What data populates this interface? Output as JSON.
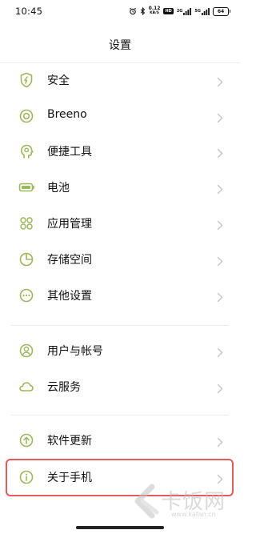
{
  "status_bar": {
    "time": "10:45",
    "net_speed_value": "0.12",
    "net_speed_unit": "KB/S",
    "hd_label": "HD",
    "sig1_label": "2G",
    "sig2_label": "5G",
    "battery": "64"
  },
  "header": {
    "title": "设置"
  },
  "menu": {
    "items": [
      {
        "label": "安全",
        "icon": "shield-bolt-icon"
      },
      {
        "label": "Breeno",
        "icon": "breeno-circle-icon"
      },
      {
        "label": "便捷工具",
        "icon": "head-gear-icon"
      },
      {
        "label": "电池",
        "icon": "battery-icon"
      },
      {
        "label": "应用管理",
        "icon": "apps-grid-icon"
      },
      {
        "label": "存储空间",
        "icon": "pie-chart-icon"
      },
      {
        "label": "其他设置",
        "icon": "more-dots-icon"
      },
      {
        "label": "用户与帐号",
        "icon": "user-account-icon"
      },
      {
        "label": "云服务",
        "icon": "cloud-icon"
      },
      {
        "label": "软件更新",
        "icon": "upload-arrow-icon"
      },
      {
        "label": "关于手机",
        "icon": "info-icon"
      }
    ]
  },
  "watermark": {
    "brand": "卡饭网",
    "url": "www.kafan.cn"
  },
  "colors": {
    "icon_accent": "#9bb85a",
    "highlight": "#e55b5b",
    "chevron": "#c4c4c4"
  }
}
